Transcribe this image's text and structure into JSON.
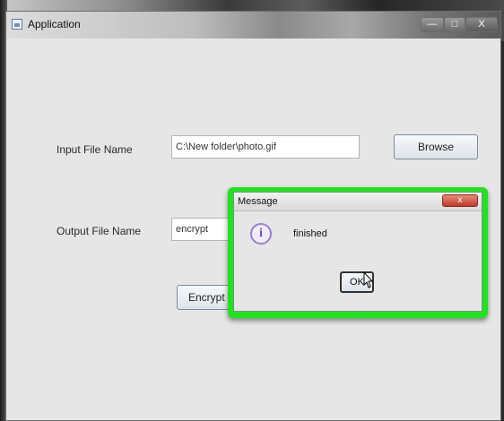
{
  "window": {
    "title": "Application",
    "minimize_symbol": "—",
    "maximize_symbol": "□",
    "close_symbol": "X"
  },
  "form": {
    "input_label": "Input File Name",
    "input_value": "C:\\New folder\\photo.gif",
    "browse_label": "Browse",
    "output_label": "Output File Name",
    "output_value": "encrypt",
    "encrypt_label": "Encrypt"
  },
  "dialog": {
    "title": "Message",
    "close_symbol": "x",
    "message": "finished",
    "info_icon_glyph": "i",
    "ok_label": "OK",
    "highlight_color": "#1fe31f"
  },
  "icons": {
    "app_icon": "window-icon",
    "info_icon": "information-icon",
    "cursor": "pointer-cursor-icon"
  }
}
